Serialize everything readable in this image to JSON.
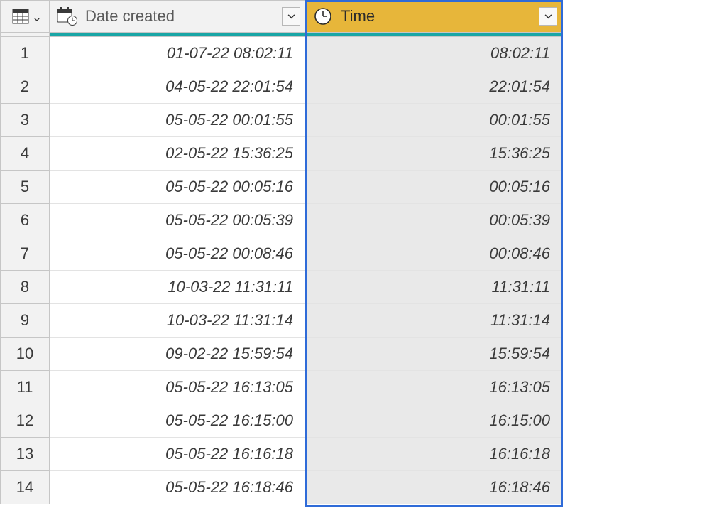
{
  "columns": {
    "date": {
      "label": "Date created"
    },
    "time": {
      "label": "Time"
    }
  },
  "rows": [
    {
      "n": "1",
      "date": "01-07-22 08:02:11",
      "time": "08:02:11"
    },
    {
      "n": "2",
      "date": "04-05-22 22:01:54",
      "time": "22:01:54"
    },
    {
      "n": "3",
      "date": "05-05-22 00:01:55",
      "time": "00:01:55"
    },
    {
      "n": "4",
      "date": "02-05-22 15:36:25",
      "time": "15:36:25"
    },
    {
      "n": "5",
      "date": "05-05-22 00:05:16",
      "time": "00:05:16"
    },
    {
      "n": "6",
      "date": "05-05-22 00:05:39",
      "time": "00:05:39"
    },
    {
      "n": "7",
      "date": "05-05-22 00:08:46",
      "time": "00:08:46"
    },
    {
      "n": "8",
      "date": "10-03-22 11:31:11",
      "time": "11:31:11"
    },
    {
      "n": "9",
      "date": "10-03-22 11:31:14",
      "time": "11:31:14"
    },
    {
      "n": "10",
      "date": "09-02-22 15:59:54",
      "time": "15:59:54"
    },
    {
      "n": "11",
      "date": "05-05-22 16:13:05",
      "time": "16:13:05"
    },
    {
      "n": "12",
      "date": "05-05-22 16:15:00",
      "time": "16:15:00"
    },
    {
      "n": "13",
      "date": "05-05-22 16:16:18",
      "time": "16:16:18"
    },
    {
      "n": "14",
      "date": "05-05-22 16:18:46",
      "time": "16:18:46"
    }
  ]
}
